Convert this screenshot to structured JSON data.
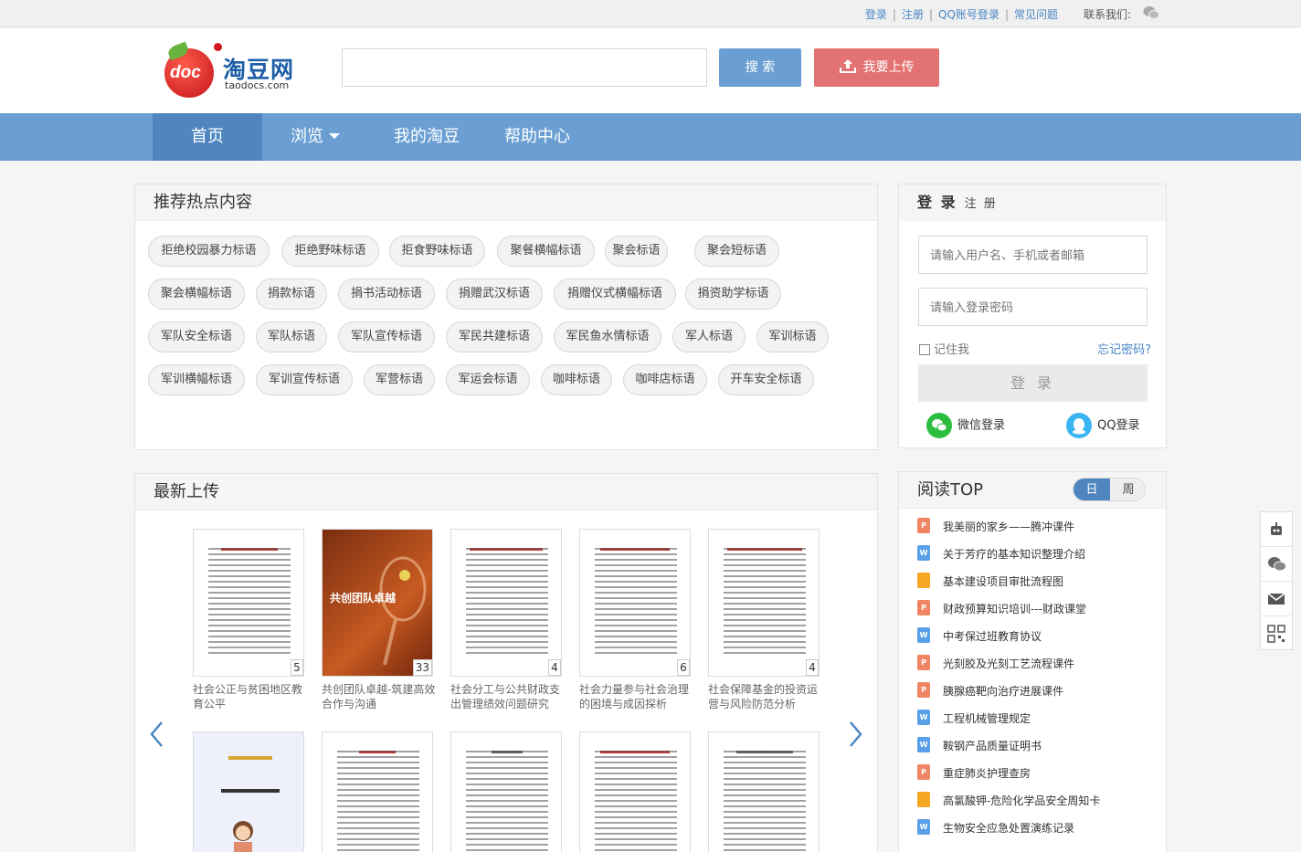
{
  "topbar": {
    "links": [
      "登录",
      "注册",
      "QQ账号登录",
      "常见问题"
    ],
    "contact_label": "联系我们:"
  },
  "logo": {
    "cn": "淘豆网",
    "en": "taodocs.com",
    "badge": "doc"
  },
  "search": {
    "button": "搜 索",
    "upload": "我要上传",
    "placeholder": ""
  },
  "nav": {
    "items": [
      "首页",
      "浏览",
      "我的淘豆",
      "帮助中心"
    ]
  },
  "hot": {
    "title": "推荐热点内容",
    "tags": [
      "拒绝校园暴力标语",
      "拒绝野味标语",
      "拒食野味标语",
      "聚餐横幅标语",
      "聚会标语",
      "聚会短标语",
      "聚会横幅标语",
      "捐款标语",
      "捐书活动标语",
      "捐赠武汉标语",
      "捐赠仪式横幅标语",
      "捐资助学标语",
      "军队安全标语",
      "军队标语",
      "军队宣传标语",
      "军民共建标语",
      "军民鱼水情标语",
      "军人标语",
      "军训标语",
      "军训横幅标语",
      "军训宣传标语",
      "军营标语",
      "军运会标语",
      "咖啡标语",
      "咖啡店标语",
      "开车安全标语"
    ]
  },
  "login": {
    "tab_login": "登 录",
    "tab_register": "注 册",
    "username_placeholder": "请输入用户名、手机或者邮箱",
    "password_placeholder": "请输入登录密码",
    "remember": "记住我",
    "forgot": "忘记密码?",
    "button": "登 录",
    "wechat": "微信登录",
    "qq": "QQ登录"
  },
  "latest": {
    "title": "最新上传",
    "docs": [
      {
        "name": "社会公正与贫困地区教育公平",
        "pages": "5"
      },
      {
        "name": "共创团队卓越-筑建高效合作与沟通",
        "pages": "33",
        "cover_text": "共创团队卓越"
      },
      {
        "name": "社会分工与公共财政支出管理绩效问题研究",
        "pages": "4"
      },
      {
        "name": "社会力量参与社会治理的困境与成因探析",
        "pages": "6"
      },
      {
        "name": "社会保障基金的投资运营与风险防范分析",
        "pages": "4"
      }
    ]
  },
  "top": {
    "title": "阅读TOP",
    "tab_day": "日",
    "tab_week": "周",
    "items": [
      {
        "type": "P",
        "title": "我美丽的家乡——腾冲课件"
      },
      {
        "type": "W",
        "title": "关于芳疗的基本知识整理介绍"
      },
      {
        "type": "PDF",
        "title": "基本建设项目审批流程图"
      },
      {
        "type": "P",
        "title": "财政预算知识培训---财政课堂"
      },
      {
        "type": "W",
        "title": "中考保过班教育协议"
      },
      {
        "type": "P",
        "title": "光刻胶及光刻工艺流程课件"
      },
      {
        "type": "P",
        "title": "胰腺癌靶向治疗进展课件"
      },
      {
        "type": "W",
        "title": "工程机械管理规定"
      },
      {
        "type": "W",
        "title": "鞍钢产品质量证明书"
      },
      {
        "type": "P",
        "title": "重症肺炎护理查房"
      },
      {
        "type": "PDF",
        "title": "高氯酸钾-危险化学品安全周知卡"
      },
      {
        "type": "W",
        "title": "生物安全应急处置演练记录"
      }
    ]
  },
  "colors": {
    "nav": "#6b9fd3",
    "nav_active": "#4f86c0",
    "upload": "#e37272",
    "link": "#4a86c5"
  }
}
